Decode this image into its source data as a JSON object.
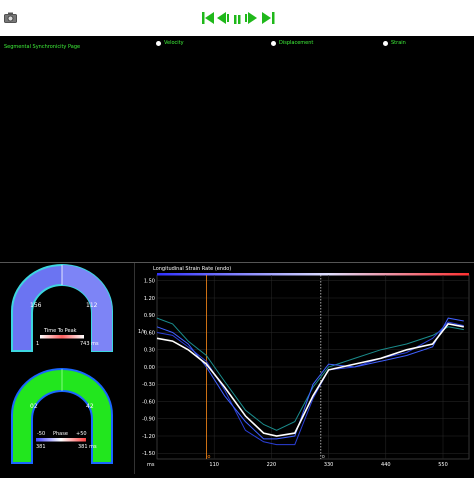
{
  "toolbar": {
    "camera_icon": "camera-icon",
    "playback_icons": [
      "skip-start-icon",
      "step-back-icon",
      "pause-icon",
      "step-forward-icon",
      "skip-end-icon"
    ],
    "accent_color": "#3ff23a"
  },
  "header": {
    "title": "Segmental Synchronicity Page",
    "options": [
      "Velocity",
      "Displacement",
      "Strain"
    ]
  },
  "bullseye_top": {
    "left_value": "156",
    "right_value": "112",
    "label": "Time To Peak",
    "scale_min": "1",
    "scale_max": "743 ms"
  },
  "bullseye_bottom": {
    "left_value": "02",
    "right_value": "42",
    "label": "Phase",
    "scale_left_top": "-50",
    "scale_right_top": "+50",
    "scale_left_bottom": "381",
    "scale_right_bottom": "381 ms"
  },
  "chart_data": {
    "type": "line",
    "title": "Longitudinal Strain Rate (endo)",
    "ylabel": "1/s",
    "xlabel": "ms",
    "y_ticks": [
      "1.50",
      "1.20",
      "0.90",
      "0.60",
      "0.30",
      "0.00",
      "-0.30",
      "-0.60",
      "-0.90",
      "-1.20",
      "-1.50"
    ],
    "x_ticks": [
      "110",
      "220",
      "330",
      "440",
      "550"
    ],
    "ylim": [
      -1.6,
      1.6
    ],
    "xlim": [
      0,
      600
    ],
    "markers": [
      {
        "label": "o",
        "x": 95,
        "color": "#ff8c1a"
      },
      {
        "label": "o",
        "x": 315,
        "color": "#cccccc"
      }
    ],
    "series": [
      {
        "color": "#ffffff",
        "x": [
          0,
          30,
          60,
          95,
          130,
          170,
          205,
          230,
          265,
          300,
          330,
          380,
          430,
          480,
          530,
          560,
          590
        ],
        "y": [
          0.5,
          0.45,
          0.3,
          0.05,
          -0.35,
          -0.85,
          -1.15,
          -1.2,
          -1.15,
          -0.5,
          -0.05,
          0.05,
          0.15,
          0.3,
          0.4,
          0.75,
          0.7
        ]
      },
      {
        "color": "#2b3fd6",
        "x": [
          0,
          30,
          60,
          95,
          130,
          170,
          205,
          230,
          265,
          300,
          330,
          380,
          430,
          480,
          530,
          560,
          590
        ],
        "y": [
          0.6,
          0.55,
          0.35,
          0.1,
          -0.4,
          -1.1,
          -1.3,
          -1.35,
          -1.35,
          -0.55,
          -0.05,
          0.0,
          0.15,
          0.25,
          0.5,
          0.78,
          0.72
        ]
      },
      {
        "color": "#1a8c8c",
        "x": [
          0,
          30,
          60,
          95,
          130,
          170,
          205,
          230,
          265,
          300,
          330,
          380,
          430,
          480,
          530,
          560,
          590
        ],
        "y": [
          0.85,
          0.75,
          0.45,
          0.2,
          -0.25,
          -0.75,
          -1.0,
          -1.1,
          -0.95,
          -0.35,
          0.0,
          0.15,
          0.3,
          0.4,
          0.55,
          0.7,
          0.65
        ]
      },
      {
        "color": "#4060ff",
        "x": [
          0,
          30,
          60,
          95,
          130,
          170,
          205,
          230,
          265,
          300,
          330,
          380,
          430,
          480,
          530,
          560,
          590
        ],
        "y": [
          0.7,
          0.6,
          0.4,
          0.0,
          -0.5,
          -0.95,
          -1.25,
          -1.25,
          -1.2,
          -0.3,
          0.05,
          0.0,
          0.1,
          0.2,
          0.35,
          0.85,
          0.8
        ]
      }
    ]
  }
}
